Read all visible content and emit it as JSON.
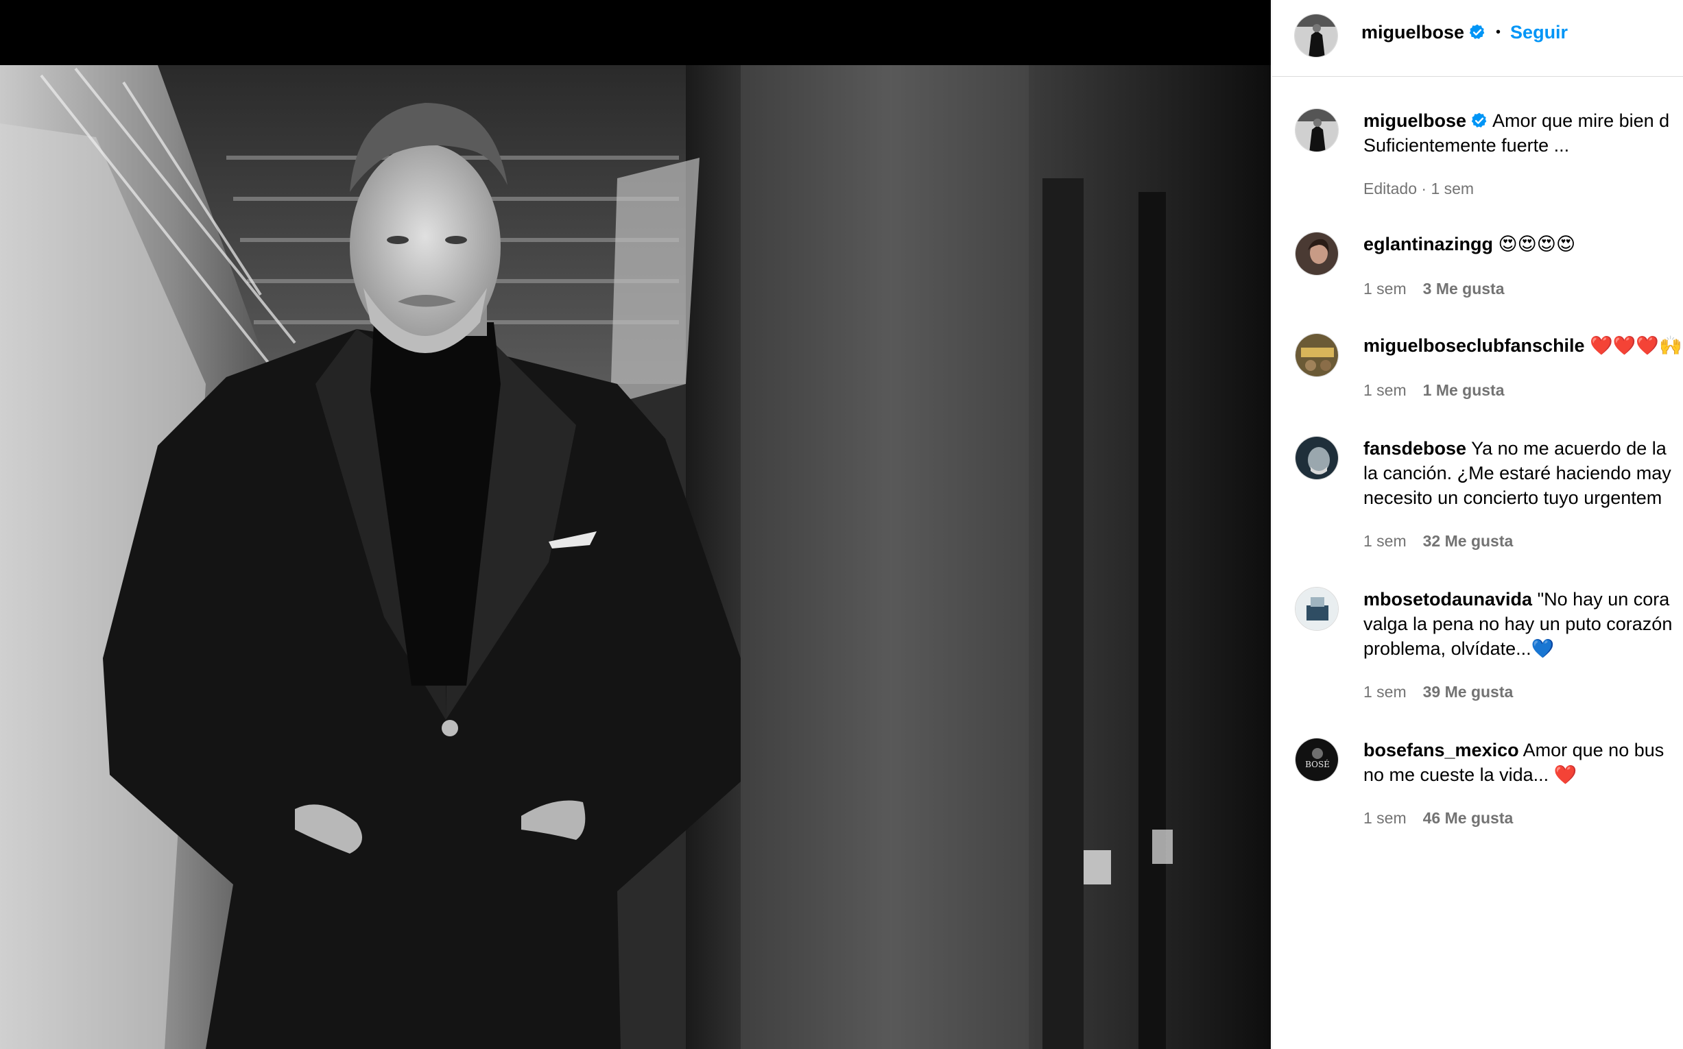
{
  "post": {
    "author": "miguelbose",
    "follow_label": "Seguir",
    "dot": "•",
    "caption_line1": "Amor que mire bien d",
    "caption_line2": "Suficientemente fuerte ...",
    "caption_meta": "Editado · 1 sem"
  },
  "comments": [
    {
      "user": "eglantinazingg",
      "lines": [
        "😍😍😍😍"
      ],
      "time": "1 sem",
      "likes": "3 Me gusta"
    },
    {
      "user": "miguelboseclubfanschile",
      "lines": [
        "❤️❤️❤️🙌❤"
      ],
      "time": "1 sem",
      "likes": "1 Me gusta"
    },
    {
      "user": "fansdebose",
      "lines": [
        "Ya no me acuerdo de la",
        "la canción. ¿Me estaré haciendo may",
        "necesito un concierto tuyo urgentem"
      ],
      "time": "1 sem",
      "likes": "32 Me gusta"
    },
    {
      "user": "mbosetodaunavida",
      "lines": [
        "\"No hay un cora",
        "valga la pena no hay un puto corazón",
        "problema, olvídate...💙"
      ],
      "time": "1 sem",
      "likes": "39 Me gusta"
    },
    {
      "user": "bosefans_mexico",
      "lines": [
        "Amor que no bus",
        "no me cueste la vida... ❤️"
      ],
      "time": "1 sem",
      "likes": "46 Me gusta"
    }
  ],
  "avatars": {
    "bosefans_mexico_logo": "BOSÉ"
  },
  "colors": {
    "accent": "#0095f6",
    "secondary_text": "#737373",
    "verified": "#0095f6"
  }
}
